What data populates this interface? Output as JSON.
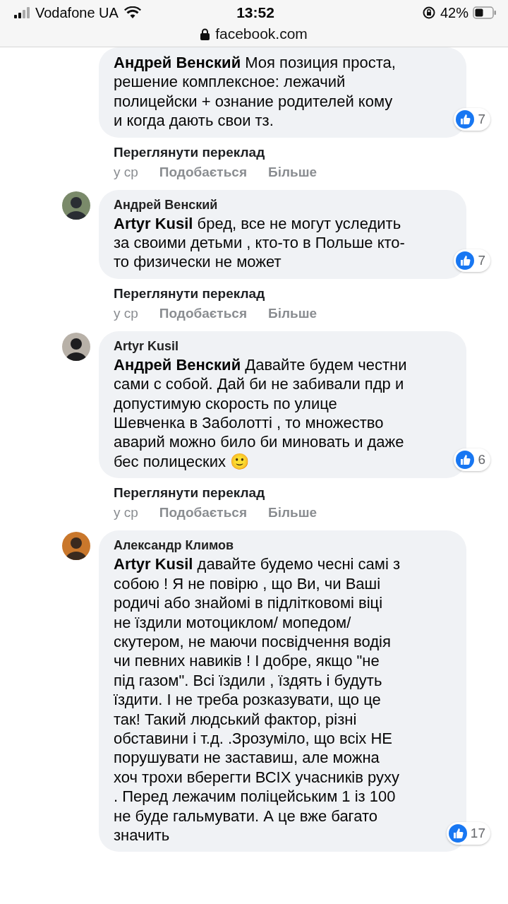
{
  "status_bar": {
    "carrier": "Vodafone UA",
    "time": "13:52",
    "battery": "42%"
  },
  "address_bar": {
    "url": "facebook.com"
  },
  "comments": [
    {
      "text": "**Андрей Венский** Моя позиция проста,\nрешение комплексное: лежачий\nполицейски + ознание родителей кому\nи когда дають свои тз.",
      "likes": "7",
      "translate": "Переглянути переклад",
      "time": "у ср",
      "like_action": "Подобається",
      "more_action": "Більше"
    },
    {
      "author": "Андрей Венский",
      "text": "**Artyr Kusil** бред, все не могут уследить\nза своими детьми , кто-то в Польше кто-\nто физически не может",
      "likes": "7",
      "translate": "Переглянути переклад",
      "time": "у ср",
      "like_action": "Подобається",
      "more_action": "Більше"
    },
    {
      "author": "Artyr Kusil",
      "text": "**Андрей Венский** Давайте будем честни\nсами с собой. Дай би не забивали пдр и\nдопустимую скорость по улице\nШевченка в Заболотті , то множество\nаварий можно било би миновать и даже\nбес полицеских 🙂",
      "likes": "6",
      "translate": "Переглянути переклад",
      "time": "у ср",
      "like_action": "Подобається",
      "more_action": "Більше"
    },
    {
      "author": "Александр Климов",
      "text": "**Artyr Kusil** давайте будемо чесні самі з\nсобою ! Я не повірю , що Ви, чи Ваші\nродичі або знайомі в підлітковомі віці\nне їздили мотоциклом/ мопедом/\nскутером, не маючи посвідчення водія\nчи певних навиків ! І добре, якщо \"не\nпід газом\". Всі їздили , їздять і будуть\nїздити. І не треба розказувати, що це\nтак! Такий людський фактор, різні\nобставини і т.д. .Зрозуміло, що всіх НЕ\nпорушувати не заставиш, але можна\nхоч трохи вберегти ВСІХ учасників руху\n. Перед лежачим поліцейським 1 із 100\nне буде гальмувати. А це вже багато\nзначить",
      "likes": "17"
    }
  ]
}
